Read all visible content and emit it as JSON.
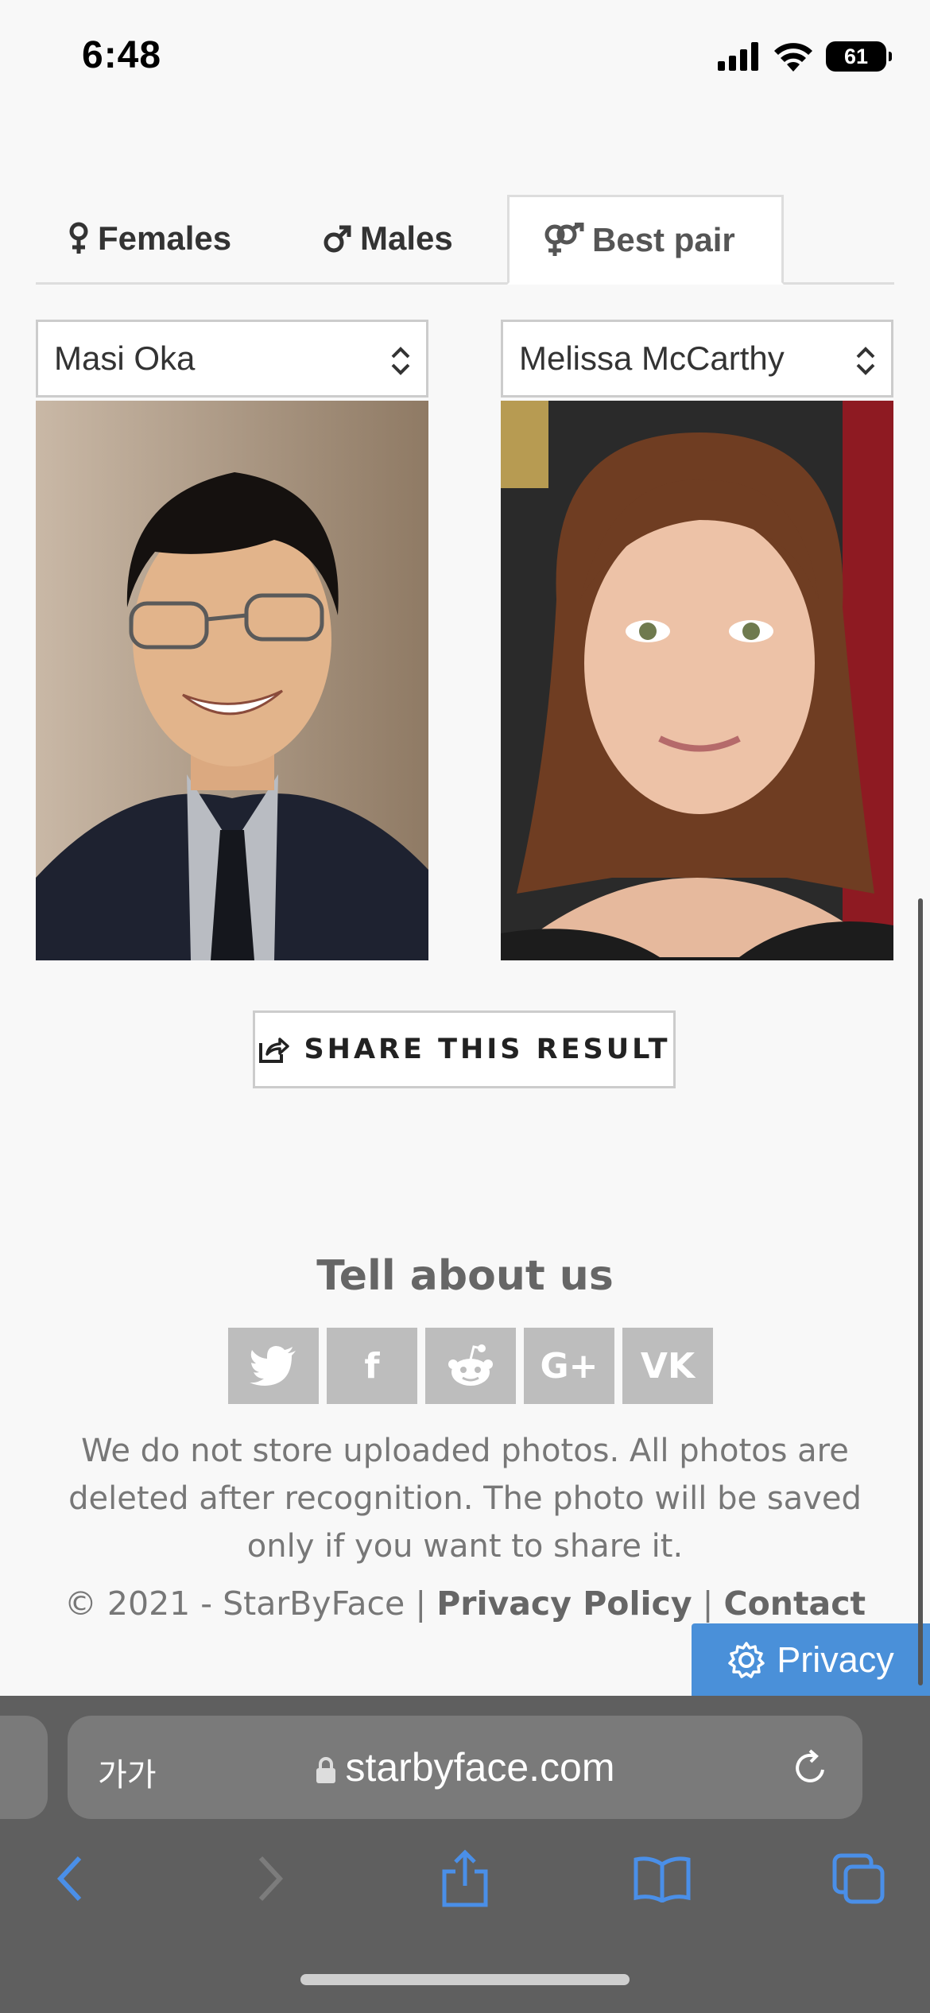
{
  "status": {
    "time": "6:48",
    "battery": "61"
  },
  "tabs": [
    {
      "label": "Females",
      "icon": "female-icon",
      "active": false
    },
    {
      "label": "Males",
      "icon": "male-icon",
      "active": false
    },
    {
      "label": "Best pair",
      "icon": "pair-icon",
      "active": true
    }
  ],
  "selects": {
    "left": "Masi Oka",
    "right": "Melissa McCarthy"
  },
  "share": {
    "label": "SHARE THIS RESULT"
  },
  "footer": {
    "heading": "Tell about us",
    "social": [
      {
        "icon": "twitter-icon"
      },
      {
        "icon": "facebook-icon",
        "glyph": "f"
      },
      {
        "icon": "reddit-icon"
      },
      {
        "icon": "google-plus-icon",
        "glyph": "G+"
      },
      {
        "icon": "vk-icon",
        "glyph": "VK"
      }
    ],
    "disclaimer": "We do not store uploaded photos. All photos are deleted after recognition. The photo will be saved only if you want to share it.",
    "copyright": "© 2021 - StarByFace",
    "separator": "|",
    "privacy_policy": "Privacy Policy",
    "contact": "Contact",
    "privacy_button": "Privacy"
  },
  "browser": {
    "aa": "가가",
    "url": "starbyface.com"
  }
}
